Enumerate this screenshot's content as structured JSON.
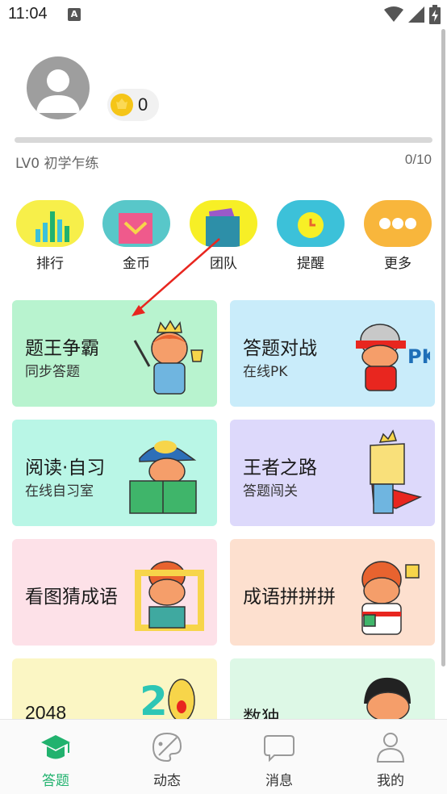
{
  "status_bar": {
    "time": "11:04",
    "notification_badge": "A",
    "icons": [
      "wifi-icon",
      "signal-icon",
      "battery-charging-icon"
    ]
  },
  "profile": {
    "coins": "0",
    "level_label": "LV0 初学乍练",
    "level_progress": "0/10",
    "level_fraction": 0
  },
  "quick_actions": [
    {
      "label": "排行",
      "icon": "ranking-icon",
      "color": "#f7ef4a"
    },
    {
      "label": "金币",
      "icon": "coin-envelope-icon",
      "color": "#58c7c9"
    },
    {
      "label": "团队",
      "icon": "team-flag-icon",
      "color": "#f7ef26"
    },
    {
      "label": "提醒",
      "icon": "reminder-clock-icon",
      "color": "#3cc1d9"
    },
    {
      "label": "更多",
      "icon": "more-dots-icon",
      "color": "#f8b63c"
    }
  ],
  "cards": [
    {
      "title": "题王争霸",
      "subtitle": "同步答题",
      "color": "#b8f3cf",
      "icon": "king-with-trophy-icon"
    },
    {
      "title": "答题对战",
      "subtitle": "在线PK",
      "color": "#c9ecfa",
      "icon": "pk-battle-icon"
    },
    {
      "title": "阅读·自习",
      "subtitle": "在线自习室",
      "color": "#b9f6e6",
      "icon": "reading-boy-icon"
    },
    {
      "title": "王者之路",
      "subtitle": "答题闯关",
      "color": "#ddd9fb",
      "icon": "caped-king-icon"
    },
    {
      "title": "看图猜成语",
      "subtitle": "",
      "color": "#fde1e8",
      "icon": "picture-frame-boy-icon"
    },
    {
      "title": "成语拼拼拼",
      "subtitle": "",
      "color": "#fde0cf",
      "icon": "puzzle-boy-icon"
    },
    {
      "title": "2048",
      "subtitle": "",
      "color": "#fbf6c4",
      "icon": "2048-number-icon"
    },
    {
      "title": "数独",
      "subtitle": "",
      "color": "#ddf8e6",
      "icon": "sudoku-boy-icon"
    }
  ],
  "bottom_nav": [
    {
      "label": "答题",
      "icon": "graduation-cap-icon",
      "active": true
    },
    {
      "label": "动态",
      "icon": "palette-icon",
      "active": false
    },
    {
      "label": "消息",
      "icon": "chat-bubble-icon",
      "active": false
    },
    {
      "label": "我的",
      "icon": "user-profile-icon",
      "active": false
    }
  ],
  "colors": {
    "accent": "#21b26e",
    "annotation_arrow": "#e8261f"
  }
}
